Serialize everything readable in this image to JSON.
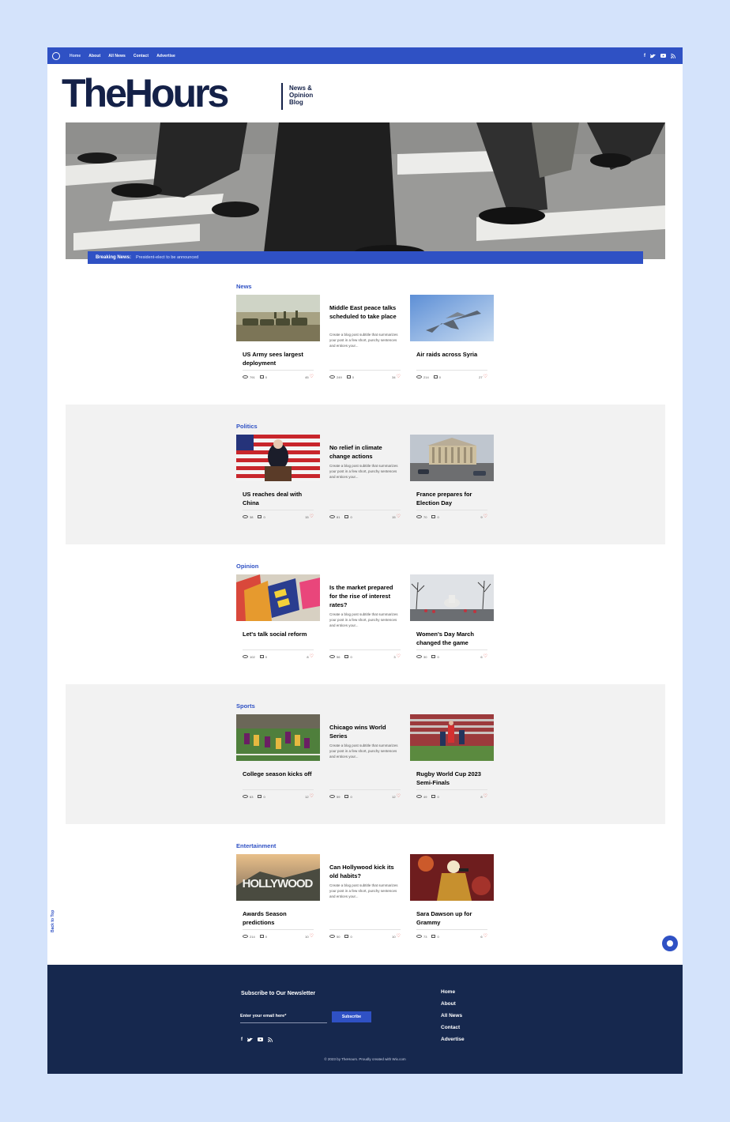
{
  "nav": {
    "links": [
      "Home",
      "About",
      "All News",
      "Contact",
      "Advertise"
    ],
    "active": "Home"
  },
  "social_icons": [
    "facebook-icon",
    "twitter-icon",
    "youtube-icon",
    "rss-icon"
  ],
  "brand": {
    "name": "TheHours",
    "tagline": "News & Opinion Blog"
  },
  "breaking": {
    "label": "Breaking News:",
    "text": "President-elect to be announced"
  },
  "sections": [
    {
      "title": "News",
      "cards": [
        {
          "title": "US Army sees largest deployment",
          "views": "791",
          "comments": "0",
          "likes": "45"
        },
        {
          "title": "Middle East peace talks scheduled to take place",
          "desc": "Create a blog post subtitle that summarizes your post in a few short, punchy sentences and entices your...",
          "views": "249",
          "comments": "0",
          "likes": "34"
        },
        {
          "title": "Air raids across Syria",
          "views": "214",
          "comments": "0",
          "likes": "27"
        }
      ]
    },
    {
      "title": "Politics",
      "cards": [
        {
          "title": "US reaches deal with China",
          "views": "38",
          "comments": "0",
          "likes": "15"
        },
        {
          "title": "No relief in climate change actions",
          "desc": "Create a blog post subtitle that summarizes your post in a few short, punchy sentences and entices your...",
          "views": "81",
          "comments": "0",
          "likes": "15"
        },
        {
          "title": "France prepares for Election Day",
          "views": "70",
          "comments": "0",
          "likes": "9"
        }
      ]
    },
    {
      "title": "Opinion",
      "cards": [
        {
          "title": "Let's talk social reform",
          "views": "102",
          "comments": "0",
          "likes": "8"
        },
        {
          "title": "Is the market prepared for the rise of interest rates?",
          "desc": "Create a blog post subtitle that summarizes your post in a few short, punchy sentences and entices your...",
          "views": "56",
          "comments": "0",
          "likes": "3"
        },
        {
          "title": "Women's Day March changed the game",
          "views": "30",
          "comments": "0",
          "likes": "6"
        }
      ]
    },
    {
      "title": "Sports",
      "cards": [
        {
          "title": "College season kicks off",
          "views": "63",
          "comments": "0",
          "likes": "12"
        },
        {
          "title": "Chicago wins World Series",
          "desc": "Create a blog post subtitle that summarizes your post in a few short, punchy sentences and entices your...",
          "views": "59",
          "comments": "0",
          "likes": "12"
        },
        {
          "title": "Rugby World Cup 2023 Semi-Finals",
          "views": "49",
          "comments": "0",
          "likes": "8"
        }
      ]
    },
    {
      "title": "Entertainment",
      "cards": [
        {
          "title": "Awards Season predictions",
          "views": "214",
          "comments": "0",
          "likes": "10"
        },
        {
          "title": "Can Hollywood kick its old habits?",
          "desc": "Create a blog post subtitle that summarizes your post in a few short, punchy sentences and entices your...",
          "views": "50",
          "comments": "0",
          "likes": "10"
        },
        {
          "title": "Sara Dawson up for Grammy",
          "views": "73",
          "comments": "0",
          "likes": "6"
        }
      ]
    }
  ],
  "hollywood_sign": "HOLLYWOOD",
  "back_to_top": "Back to Top",
  "footer": {
    "newsletter_title": "Subscribe to Our Newsletter",
    "email_placeholder": "Enter your email here*",
    "subscribe": "Subscribe",
    "links": [
      "Home",
      "About",
      "All News",
      "Contact",
      "Advertise"
    ],
    "copyright": "© 2023 by TheHours. Proudly created with Wix.com"
  },
  "colors": {
    "accent": "#2f51c4",
    "brand": "#142148",
    "footer_bg": "#16284e",
    "page_bg": "#d4e3fb",
    "heart": "#e8453c"
  }
}
